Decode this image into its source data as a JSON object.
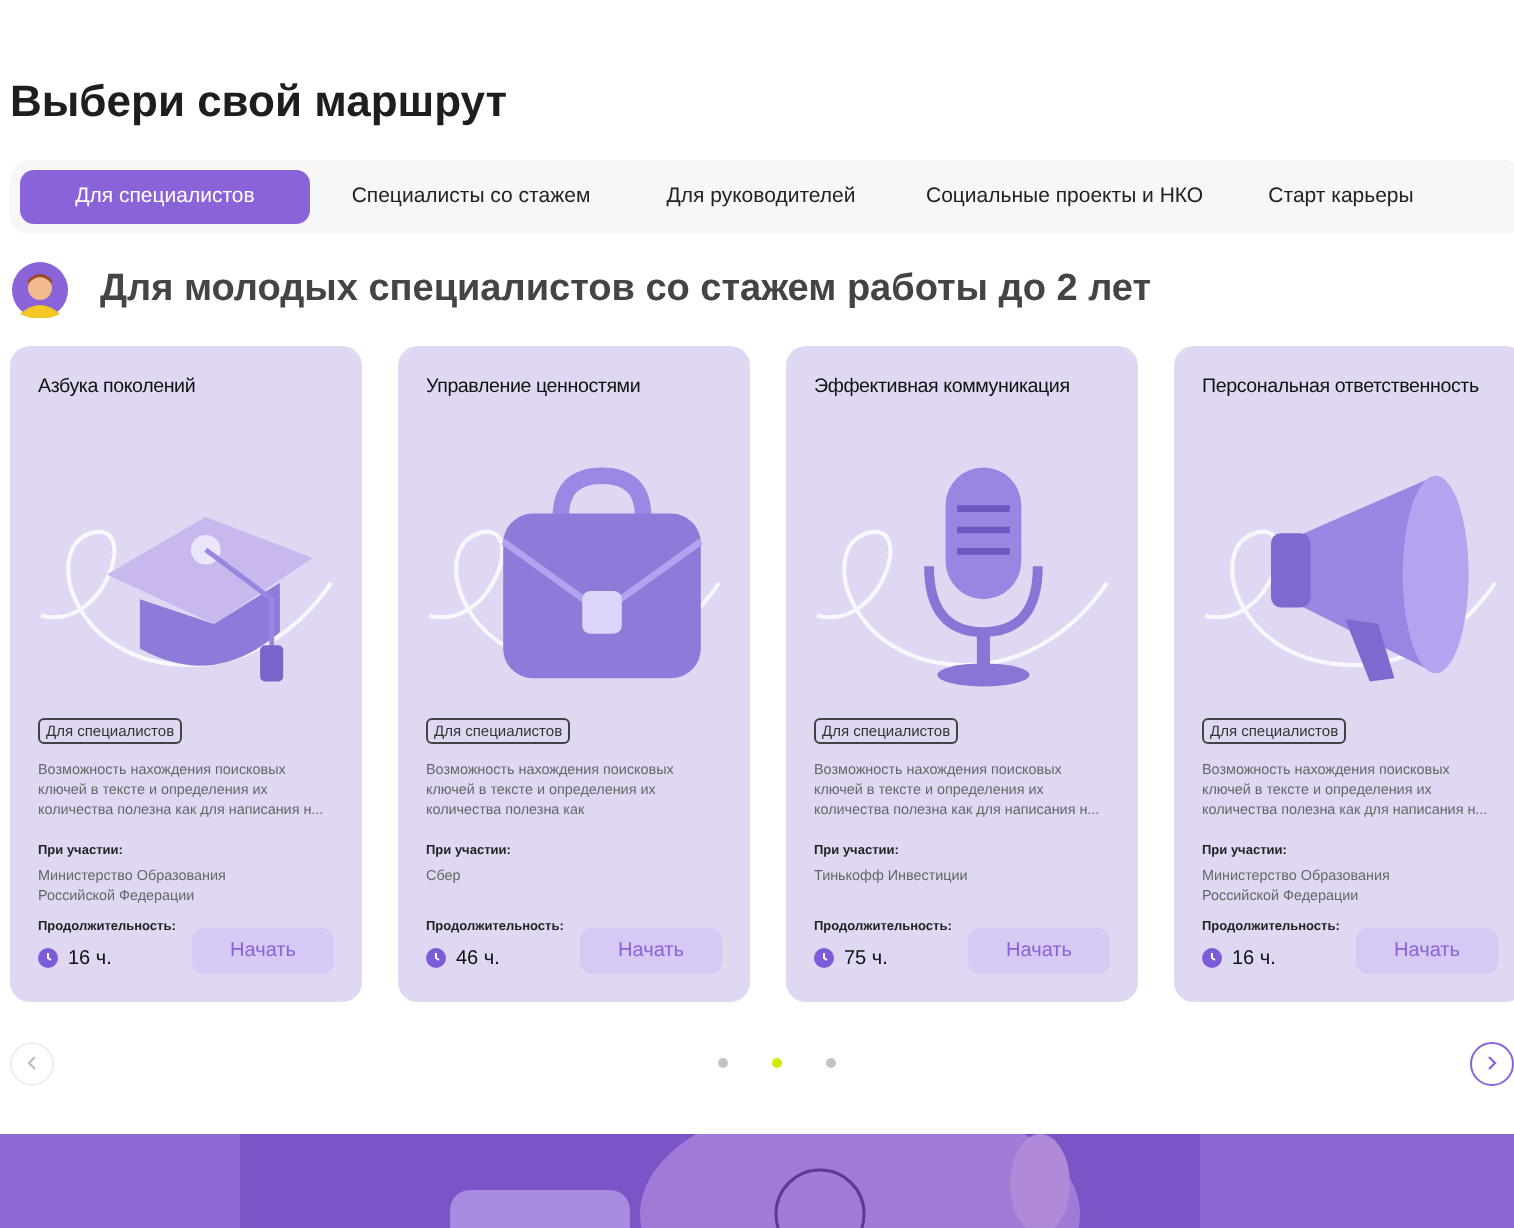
{
  "title": "Выбери свой маршрут",
  "tabs": [
    {
      "label": "Для специалистов",
      "selected": true
    },
    {
      "label": "Специалисты со стажем",
      "selected": false
    },
    {
      "label": "Для руководителей",
      "selected": false
    },
    {
      "label": "Социальные проекты и НКО",
      "selected": false
    },
    {
      "label": "Старт карьеры",
      "selected": false
    }
  ],
  "section": {
    "heading": "Для молодых специалистов со стажем работы до 2 лет"
  },
  "cards": [
    {
      "title": "Азбука поколений",
      "tag": "Для специалистов",
      "description": "Возможность нахождения поисковых ключей в тексте и определения их количества полезна как для написания н...",
      "partner_label": "При участии:",
      "partner": "Министерство Образования Российской Федерации",
      "duration_label": "Продолжительность:",
      "duration": "16 ч.",
      "button": "Начать"
    },
    {
      "title": "Управление ценностями",
      "tag": "Для специалистов",
      "description": "Возможность нахождения поисковых ключей в тексте и определения их количества полезна как",
      "partner_label": "При участии:",
      "partner": "Сбер",
      "duration_label": "Продолжительность:",
      "duration": "46 ч.",
      "button": "Начать"
    },
    {
      "title": "Эффективная коммуникация",
      "tag": "Для специалистов",
      "description": "Возможность нахождения поисковых ключей в тексте и определения их количества полезна как для написания н...",
      "partner_label": "При участии:",
      "partner": "Тинькофф Инвестиции",
      "duration_label": "Продолжительность:",
      "duration": "75 ч.",
      "button": "Начать"
    },
    {
      "title": "Персональная ответственность",
      "tag": "Для специалистов",
      "description": "Возможность нахождения поисковых ключей в тексте и определения их количества полезна как для написания н...",
      "partner_label": "При участии:",
      "partner": "Министерство Образования Российской Федерации",
      "duration_label": "Продолжительность:",
      "duration": "16 ч.",
      "button": "Начать"
    }
  ],
  "pager": [
    {
      "selected": false
    },
    {
      "selected": true
    },
    {
      "selected": false
    }
  ]
}
